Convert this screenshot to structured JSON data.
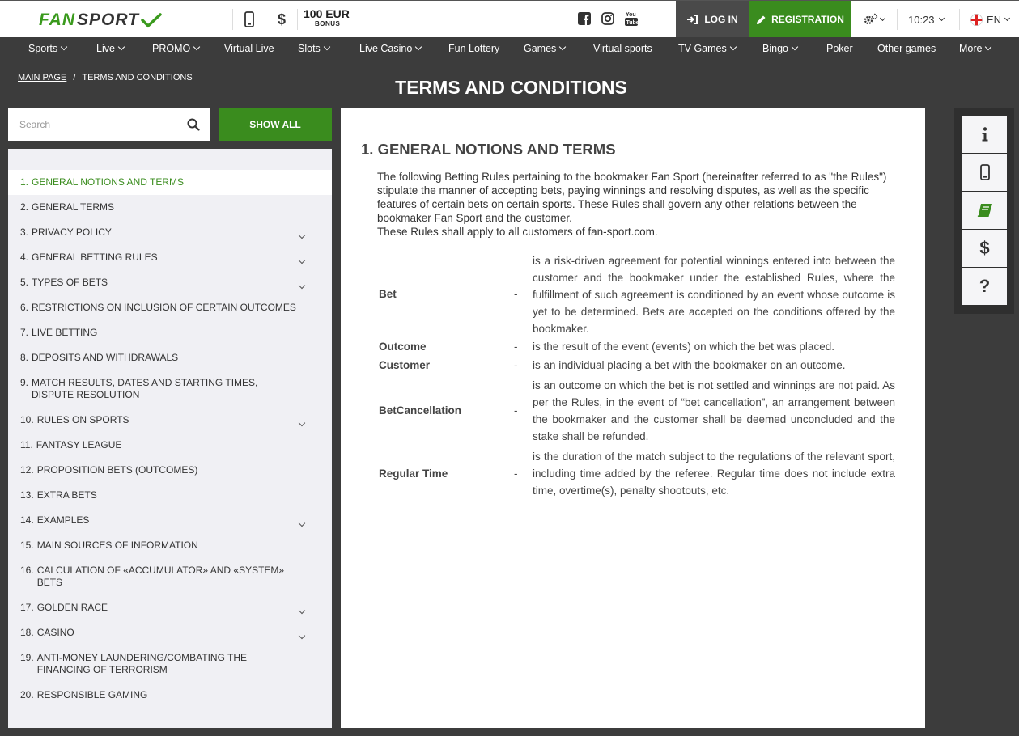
{
  "header": {
    "logo_fan": "FAN",
    "logo_sport": "SPORT",
    "bonus_amount": "100 EUR",
    "bonus_label": "BONUS",
    "login_label": "LOG IN",
    "registration_label": "REGISTRATION",
    "time": "10:23",
    "language": "EN"
  },
  "nav": [
    {
      "label": "Sports",
      "dropdown": true
    },
    {
      "label": "Live",
      "dropdown": true
    },
    {
      "label": "PROMO",
      "dropdown": true
    },
    {
      "label": "Virtual Live",
      "dropdown": false
    },
    {
      "label": "Slots",
      "dropdown": true
    },
    {
      "label": "Live Casino",
      "dropdown": true
    },
    {
      "label": "Fun Lottery",
      "dropdown": false
    },
    {
      "label": "Games",
      "dropdown": true
    },
    {
      "label": "Virtual sports",
      "dropdown": false
    },
    {
      "label": "TV Games",
      "dropdown": true
    },
    {
      "label": "Bingo",
      "dropdown": true
    },
    {
      "label": "Poker",
      "dropdown": false
    },
    {
      "label": "Other games",
      "dropdown": false
    },
    {
      "label": "More",
      "dropdown": true
    }
  ],
  "breadcrumb": {
    "home": "MAIN PAGE",
    "separator": "/",
    "current": "TERMS AND CONDITIONS"
  },
  "page_title": "TERMS AND CONDITIONS",
  "search": {
    "placeholder": "Search",
    "show_all_label": "SHOW ALL"
  },
  "sidebar": {
    "items": [
      {
        "num": "1.",
        "label": "GENERAL NOTIONS AND TERMS",
        "active": true,
        "expandable": false
      },
      {
        "num": "2.",
        "label": "GENERAL TERMS",
        "active": false,
        "expandable": false
      },
      {
        "num": "3.",
        "label": "PRIVACY POLICY",
        "active": false,
        "expandable": true
      },
      {
        "num": "4.",
        "label": "GENERAL BETTING RULES",
        "active": false,
        "expandable": true
      },
      {
        "num": "5.",
        "label": "TYPES OF BETS",
        "active": false,
        "expandable": true
      },
      {
        "num": "6.",
        "label": "RESTRICTIONS ON INCLUSION OF CERTAIN OUTCOMES",
        "active": false,
        "expandable": false
      },
      {
        "num": "7.",
        "label": "LIVE BETTING",
        "active": false,
        "expandable": false
      },
      {
        "num": "8.",
        "label": "DEPOSITS AND WITHDRAWALS",
        "active": false,
        "expandable": false
      },
      {
        "num": "9.",
        "label": "MATCH RESULTS, DATES AND STARTING TIMES, DISPUTE RESOLUTION",
        "active": false,
        "expandable": false
      },
      {
        "num": "10.",
        "label": "RULES ON SPORTS",
        "active": false,
        "expandable": true
      },
      {
        "num": "11.",
        "label": "FANTASY LEAGUE",
        "active": false,
        "expandable": false
      },
      {
        "num": "12.",
        "label": "PROPOSITION BETS (OUTCOMES)",
        "active": false,
        "expandable": false
      },
      {
        "num": "13.",
        "label": "EXTRA BETS",
        "active": false,
        "expandable": false
      },
      {
        "num": "14.",
        "label": "EXAMPLES",
        "active": false,
        "expandable": true
      },
      {
        "num": "15.",
        "label": "MAIN SOURCES OF INFORMATION",
        "active": false,
        "expandable": false
      },
      {
        "num": "16.",
        "label": "CALCULATION OF «ACCUMULATOR» AND «SYSTEM» BETS",
        "active": false,
        "expandable": false
      },
      {
        "num": "17.",
        "label": "GOLDEN RACE",
        "active": false,
        "expandable": true
      },
      {
        "num": "18.",
        "label": "CASINO",
        "active": false,
        "expandable": true
      },
      {
        "num": "19.",
        "label": "ANTI-MONEY LAUNDERING/COMBATING THE FINANCING OF TERRORISM",
        "active": false,
        "expandable": false
      },
      {
        "num": "20.",
        "label": "RESPONSIBLE GAMING",
        "active": false,
        "expandable": false
      }
    ]
  },
  "content": {
    "heading": "1. GENERAL NOTIONS AND TERMS",
    "intro_1": "The following Betting Rules pertaining to the bookmaker Fan Sport (hereinafter referred to as \"the Rules\") stipulate the manner of accepting bets, paying winnings and resolving disputes, as well as the specific features of certain bets on certain sports. These Rules shall govern any other relations between the bookmaker Fan Sport and the customer.",
    "intro_2": "These Rules shall apply to all customers of fan-sport.com.",
    "dash": "-",
    "definitions": [
      {
        "term": "Bet",
        "desc": "is a risk-driven agreement for potential winnings entered into between the customer and the bookmaker under the established Rules, where the fulfillment of such agreement is conditioned by an event whose outcome is yet to be determined. Bets are accepted on the conditions offered by the bookmaker."
      },
      {
        "term": "Outcome",
        "desc": "is the result of the event (events) on which the bet was placed."
      },
      {
        "term": "Customer",
        "desc": "is an individual placing a bet with the bookmaker on an outcome."
      },
      {
        "term": "BetCancellation",
        "desc": "is an outcome on which the bet is not settled and winnings are not paid. As per the Rules, in the event of “bet cancellation”, an arrangement between the bookmaker and the customer shall be deemed unconcluded and the stake shall be refunded."
      },
      {
        "term": "Regular Time",
        "desc": "is the duration of the match subject to the regulations of the relevant sport, including time added by the referee. Regular time does not include extra time, overtime(s), penalty shootouts, etc."
      }
    ]
  },
  "right_panel": {
    "buttons": [
      "info-icon",
      "mobile-icon",
      "book-icon",
      "dollar-icon",
      "question-icon"
    ]
  },
  "colors": {
    "brand_green": "#3a8c1e",
    "dark_bg": "#3c3c3c",
    "login_bg": "#4a4a4a"
  }
}
